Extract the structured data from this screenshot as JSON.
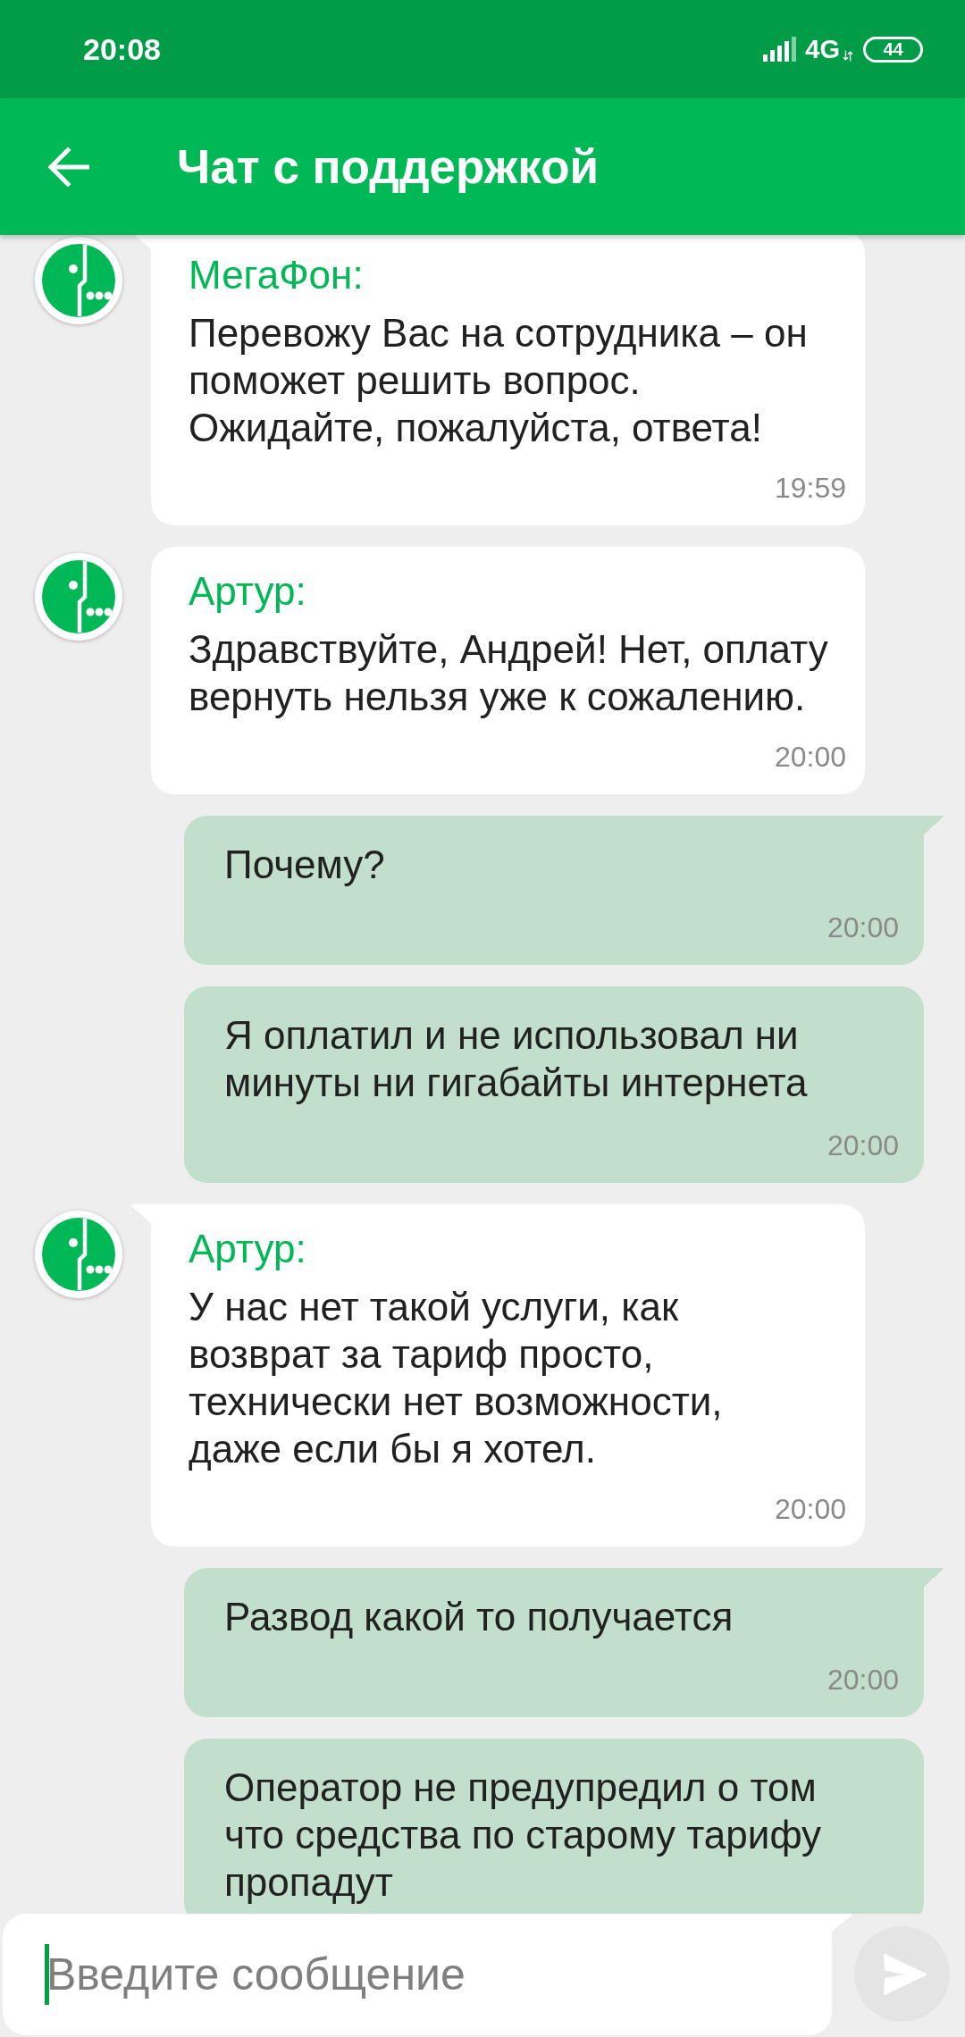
{
  "status_bar": {
    "time": "20:08",
    "network": "4G",
    "battery": "44"
  },
  "app_bar": {
    "title": "Чат с поддержкой"
  },
  "messages": [
    {
      "kind": "incoming",
      "sender": "МегаФон:",
      "text": "Перевожу Вас на сотрудника – он\nпоможет решить вопрос.\nОжидайте, пожалуйста, ответа!",
      "time": "19:59"
    },
    {
      "kind": "incoming",
      "sender": "Артур:",
      "text": "Здравствуйте, Андрей! Нет, оплату\nвернуть нельзя уже к сожалению.",
      "time": "20:00"
    },
    {
      "kind": "outgoing",
      "text": "Почему?",
      "time": "20:00"
    },
    {
      "kind": "outgoing",
      "text": "Я оплатил и не использовал ни\nминуты ни гигабайты интернета",
      "time": "20:00"
    },
    {
      "kind": "incoming",
      "sender": "Артур:",
      "text": "У нас нет такой услуги, как\nвозврат за тариф просто,\nтехнически нет возможности,\nдаже если бы я хотел.",
      "time": "20:00"
    },
    {
      "kind": "outgoing",
      "text": "Развод какой то получается",
      "time": "20:00"
    },
    {
      "kind": "outgoing",
      "text": "Оператор не предупредил о том\nчто средства по старому тарифу\nпропадут"
    }
  ],
  "composer": {
    "placeholder": "Введите сообщение",
    "focused": true,
    "send_disabled": true
  }
}
